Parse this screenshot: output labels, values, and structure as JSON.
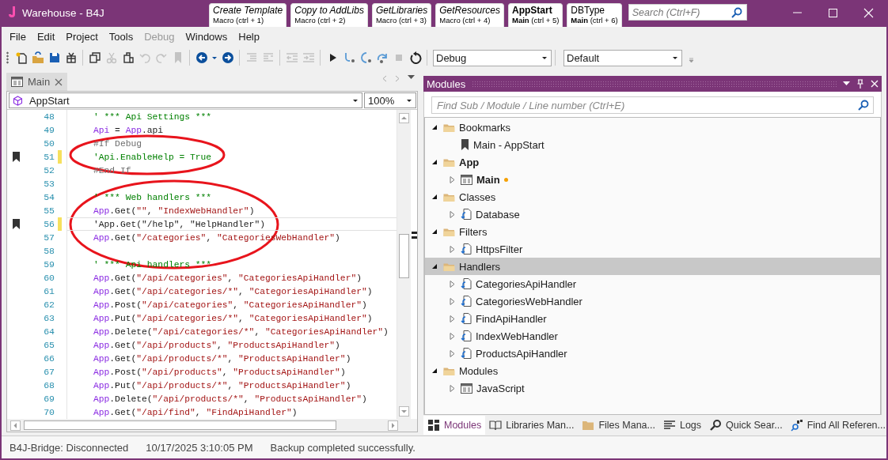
{
  "window": {
    "title": "Warehouse - B4J"
  },
  "macro_tabs": [
    {
      "title": "Create Template",
      "subtitle": "Macro (ctrl + 1)",
      "kind": "macro",
      "selected": false
    },
    {
      "title": "Copy to AddLibs",
      "subtitle": "Macro (ctrl + 2)",
      "kind": "macro",
      "selected": false
    },
    {
      "title": "GetLibraries",
      "subtitle": "Macro (ctrl + 3)",
      "kind": "macro",
      "selected": false
    },
    {
      "title": "GetResources",
      "subtitle": "Macro (ctrl + 4)",
      "kind": "macro",
      "selected": false
    },
    {
      "title": "AppStart",
      "subtitle": "**Main** (ctrl + 5)",
      "kind": "module",
      "selected": true
    },
    {
      "title": "DBType",
      "subtitle": "**Main** (ctrl + 6)",
      "kind": "module",
      "selected": false
    }
  ],
  "search": {
    "placeholder": "Search (Ctrl+F)"
  },
  "menu": [
    {
      "label": "File",
      "disabled": false
    },
    {
      "label": "Edit",
      "disabled": false
    },
    {
      "label": "Project",
      "disabled": false
    },
    {
      "label": "Tools",
      "disabled": false
    },
    {
      "label": "Debug",
      "disabled": true
    },
    {
      "label": "Windows",
      "disabled": false
    },
    {
      "label": "Help",
      "disabled": false
    }
  ],
  "toolbar": {
    "buttons": [
      {
        "disabled": false
      },
      {
        "disabled": false
      },
      {
        "disabled": false
      },
      {
        "disabled": false
      },
      {
        "disabled": false
      },
      {
        "disabled": true
      },
      {
        "disabled": false
      },
      {
        "disabled": true
      },
      {
        "disabled": true
      },
      {
        "disabled": true
      },
      {
        "disabled": false
      },
      {
        "disabled": false
      },
      {
        "disabled": false
      },
      {
        "disabled": true
      },
      {
        "disabled": true
      },
      {
        "disabled": true
      },
      {
        "disabled": true
      },
      {
        "disabled": false
      },
      {
        "disabled": false
      },
      {
        "disabled": false
      },
      {
        "disabled": false
      },
      {
        "disabled": true
      },
      {
        "disabled": false
      }
    ],
    "build_config": "Debug",
    "layout": "Default"
  },
  "editor": {
    "tabs": [
      {
        "label": "Main",
        "selected": true
      }
    ],
    "sub_selector": "AppStart",
    "zoom": "100%",
    "lines": [
      {
        "number": "48",
        "bookmark": false,
        "changed": false,
        "current": false,
        "circled": false,
        "segments": [
          {
            "kind": "comment",
            "text": "' *** Api Settings ***"
          }
        ]
      },
      {
        "number": "49",
        "bookmark": false,
        "changed": false,
        "current": false,
        "circled": false,
        "segments": [
          {
            "kind": "ident",
            "text": "Api"
          },
          {
            "kind": "plain",
            "text": " = "
          },
          {
            "kind": "ident",
            "text": "App"
          },
          {
            "kind": "plain",
            "text": ".api"
          }
        ]
      },
      {
        "number": "50",
        "bookmark": false,
        "changed": false,
        "current": false,
        "circled": true,
        "segments": [
          {
            "kind": "directive",
            "text": "#If Debug"
          }
        ]
      },
      {
        "number": "51",
        "bookmark": true,
        "changed": true,
        "current": false,
        "circled": true,
        "segments": [
          {
            "kind": "comment",
            "text": "'Api.EnableHelp = True"
          }
        ]
      },
      {
        "number": "52",
        "bookmark": false,
        "changed": false,
        "current": false,
        "circled": true,
        "segments": [
          {
            "kind": "directive",
            "text": "#End If"
          }
        ]
      },
      {
        "number": "53",
        "bookmark": false,
        "changed": false,
        "current": false,
        "circled": false
      },
      {
        "number": "54",
        "bookmark": false,
        "changed": false,
        "current": false,
        "circled": true,
        "segments": [
          {
            "kind": "comment",
            "text": "' *** Web handlers ***"
          }
        ]
      },
      {
        "number": "55",
        "bookmark": false,
        "changed": false,
        "current": false,
        "circled": true,
        "segments": [
          {
            "kind": "ident",
            "text": "App"
          },
          {
            "kind": "plain",
            "text": ".Get("
          },
          {
            "kind": "string",
            "text": "\"\""
          },
          {
            "kind": "plain",
            "text": ", "
          },
          {
            "kind": "string",
            "text": "\"IndexWebHandler\""
          },
          {
            "kind": "plain",
            "text": ")"
          }
        ]
      },
      {
        "number": "56",
        "bookmark": true,
        "changed": true,
        "current": true,
        "circled": true,
        "segments": [
          {
            "kind": "plain",
            "text": "'App.Get(\"/help\", \"HelpHandler\")"
          }
        ]
      },
      {
        "number": "57",
        "bookmark": false,
        "changed": false,
        "current": false,
        "circled": true,
        "segments": [
          {
            "kind": "ident",
            "text": "App"
          },
          {
            "kind": "plain",
            "text": ".Get("
          },
          {
            "kind": "string",
            "text": "\"/categories\""
          },
          {
            "kind": "plain",
            "text": ", "
          },
          {
            "kind": "string",
            "text": "\"CategoriesWebHandler\""
          },
          {
            "kind": "plain",
            "text": ")"
          }
        ]
      },
      {
        "number": "58",
        "bookmark": false,
        "changed": false,
        "current": false,
        "circled": true
      },
      {
        "number": "59",
        "bookmark": false,
        "changed": false,
        "current": false,
        "circled": false,
        "segments": [
          {
            "kind": "comment",
            "text": "' *** Api handlers ***"
          }
        ]
      },
      {
        "number": "60",
        "bookmark": false,
        "changed": false,
        "current": false,
        "circled": false,
        "segments": [
          {
            "kind": "ident",
            "text": "App"
          },
          {
            "kind": "plain",
            "text": ".Get("
          },
          {
            "kind": "string",
            "text": "\"/api/categories\""
          },
          {
            "kind": "plain",
            "text": ", "
          },
          {
            "kind": "string",
            "text": "\"CategoriesApiHandler\""
          },
          {
            "kind": "plain",
            "text": ")"
          }
        ]
      },
      {
        "number": "61",
        "bookmark": false,
        "changed": false,
        "current": false,
        "circled": false,
        "segments": [
          {
            "kind": "ident",
            "text": "App"
          },
          {
            "kind": "plain",
            "text": ".Get("
          },
          {
            "kind": "string",
            "text": "\"/api/categories/*\""
          },
          {
            "kind": "plain",
            "text": ", "
          },
          {
            "kind": "string",
            "text": "\"CategoriesApiHandler\""
          },
          {
            "kind": "plain",
            "text": ")"
          }
        ]
      },
      {
        "number": "62",
        "bookmark": false,
        "changed": false,
        "current": false,
        "circled": false,
        "segments": [
          {
            "kind": "ident",
            "text": "App"
          },
          {
            "kind": "plain",
            "text": ".Post("
          },
          {
            "kind": "string",
            "text": "\"/api/categories\""
          },
          {
            "kind": "plain",
            "text": ", "
          },
          {
            "kind": "string",
            "text": "\"CategoriesApiHandler\""
          },
          {
            "kind": "plain",
            "text": ")"
          }
        ]
      },
      {
        "number": "63",
        "bookmark": false,
        "changed": false,
        "current": false,
        "circled": false,
        "segments": [
          {
            "kind": "ident",
            "text": "App"
          },
          {
            "kind": "plain",
            "text": ".Put("
          },
          {
            "kind": "string",
            "text": "\"/api/categories/*\""
          },
          {
            "kind": "plain",
            "text": ", "
          },
          {
            "kind": "string",
            "text": "\"CategoriesApiHandler\""
          },
          {
            "kind": "plain",
            "text": ")"
          }
        ]
      },
      {
        "number": "64",
        "bookmark": false,
        "changed": false,
        "current": false,
        "circled": false,
        "segments": [
          {
            "kind": "ident",
            "text": "App"
          },
          {
            "kind": "plain",
            "text": ".Delete("
          },
          {
            "kind": "string",
            "text": "\"/api/categories/*\""
          },
          {
            "kind": "plain",
            "text": ", "
          },
          {
            "kind": "string",
            "text": "\"CategoriesApiHandler\""
          },
          {
            "kind": "plain",
            "text": ")"
          }
        ]
      },
      {
        "number": "65",
        "bookmark": false,
        "changed": false,
        "current": false,
        "circled": false,
        "segments": [
          {
            "kind": "ident",
            "text": "App"
          },
          {
            "kind": "plain",
            "text": ".Get("
          },
          {
            "kind": "string",
            "text": "\"/api/products\""
          },
          {
            "kind": "plain",
            "text": ", "
          },
          {
            "kind": "string",
            "text": "\"ProductsApiHandler\""
          },
          {
            "kind": "plain",
            "text": ")"
          }
        ]
      },
      {
        "number": "66",
        "bookmark": false,
        "changed": false,
        "current": false,
        "circled": false,
        "segments": [
          {
            "kind": "ident",
            "text": "App"
          },
          {
            "kind": "plain",
            "text": ".Get("
          },
          {
            "kind": "string",
            "text": "\"/api/products/*\""
          },
          {
            "kind": "plain",
            "text": ", "
          },
          {
            "kind": "string",
            "text": "\"ProductsApiHandler\""
          },
          {
            "kind": "plain",
            "text": ")"
          }
        ]
      },
      {
        "number": "67",
        "bookmark": false,
        "changed": false,
        "current": false,
        "circled": false,
        "segments": [
          {
            "kind": "ident",
            "text": "App"
          },
          {
            "kind": "plain",
            "text": ".Post("
          },
          {
            "kind": "string",
            "text": "\"/api/products\""
          },
          {
            "kind": "plain",
            "text": ", "
          },
          {
            "kind": "string",
            "text": "\"ProductsApiHandler\""
          },
          {
            "kind": "plain",
            "text": ")"
          }
        ]
      },
      {
        "number": "68",
        "bookmark": false,
        "changed": false,
        "current": false,
        "circled": false,
        "segments": [
          {
            "kind": "ident",
            "text": "App"
          },
          {
            "kind": "plain",
            "text": ".Put("
          },
          {
            "kind": "string",
            "text": "\"/api/products/*\""
          },
          {
            "kind": "plain",
            "text": ", "
          },
          {
            "kind": "string",
            "text": "\"ProductsApiHandler\""
          },
          {
            "kind": "plain",
            "text": ")"
          }
        ]
      },
      {
        "number": "69",
        "bookmark": false,
        "changed": false,
        "current": false,
        "circled": false,
        "segments": [
          {
            "kind": "ident",
            "text": "App"
          },
          {
            "kind": "plain",
            "text": ".Delete("
          },
          {
            "kind": "string",
            "text": "\"/api/products/*\""
          },
          {
            "kind": "plain",
            "text": ", "
          },
          {
            "kind": "string",
            "text": "\"ProductsApiHandler\""
          },
          {
            "kind": "plain",
            "text": ")"
          }
        ]
      },
      {
        "number": "70",
        "bookmark": false,
        "changed": false,
        "current": false,
        "circled": false,
        "segments": [
          {
            "kind": "ident",
            "text": "App"
          },
          {
            "kind": "plain",
            "text": ".Get("
          },
          {
            "kind": "string",
            "text": "\"/api/find\""
          },
          {
            "kind": "plain",
            "text": ", "
          },
          {
            "kind": "string",
            "text": "\"FindApiHandler\""
          },
          {
            "kind": "plain",
            "text": ")"
          }
        ]
      }
    ]
  },
  "modules_panel": {
    "title": "Modules",
    "search": {
      "placeholder": "Find Sub / Module / Line number (Ctrl+E)"
    },
    "tree": [
      {
        "label": "Bookmarks",
        "expanded": true,
        "selected": false,
        "bold": false,
        "children": [
          {
            "label": "Main - AppStart",
            "kind": "bookmark",
            "bold": false,
            "modified": false
          }
        ]
      },
      {
        "label": "App",
        "expanded": true,
        "selected": false,
        "bold": true,
        "children": [
          {
            "label": "Main",
            "kind": "module",
            "bold": true,
            "modified": true,
            "expanded": false
          }
        ]
      },
      {
        "label": "Classes",
        "expanded": true,
        "selected": false,
        "bold": false,
        "children": [
          {
            "label": "Database",
            "kind": "class",
            "bold": false,
            "modified": false,
            "expanded": false
          }
        ]
      },
      {
        "label": "Filters",
        "expanded": true,
        "selected": false,
        "bold": false,
        "children": [
          {
            "label": "HttpsFilter",
            "kind": "class",
            "bold": false,
            "modified": false,
            "expanded": false
          }
        ]
      },
      {
        "label": "Handlers",
        "expanded": true,
        "selected": true,
        "bold": false,
        "children": [
          {
            "label": "CategoriesApiHandler",
            "kind": "class",
            "bold": false,
            "modified": false,
            "expanded": false
          },
          {
            "label": "CategoriesWebHandler",
            "kind": "class",
            "bold": false,
            "modified": false,
            "expanded": false
          },
          {
            "label": "FindApiHandler",
            "kind": "class",
            "bold": false,
            "modified": false,
            "expanded": false
          },
          {
            "label": "IndexWebHandler",
            "kind": "class",
            "bold": false,
            "modified": false,
            "expanded": false
          },
          {
            "label": "ProductsApiHandler",
            "kind": "class",
            "bold": false,
            "modified": false,
            "expanded": false
          }
        ]
      },
      {
        "label": "Modules",
        "expanded": true,
        "selected": false,
        "bold": false,
        "children": [
          {
            "label": "JavaScript",
            "kind": "module",
            "bold": false,
            "modified": false,
            "expanded": false
          }
        ]
      }
    ],
    "tabs": [
      {
        "label": "Modules",
        "selected": true
      },
      {
        "label": "Libraries Man...",
        "selected": false
      },
      {
        "label": "Files Mana...",
        "selected": false
      },
      {
        "label": "Logs",
        "selected": false
      },
      {
        "label": "Quick Sear...",
        "selected": false
      },
      {
        "label": "Find All Referen...",
        "selected": false
      }
    ]
  },
  "status_bar": [
    "B4J-Bridge: Disconnected",
    "10/17/2025 3:10:05 PM",
    "Backup completed successfully."
  ]
}
